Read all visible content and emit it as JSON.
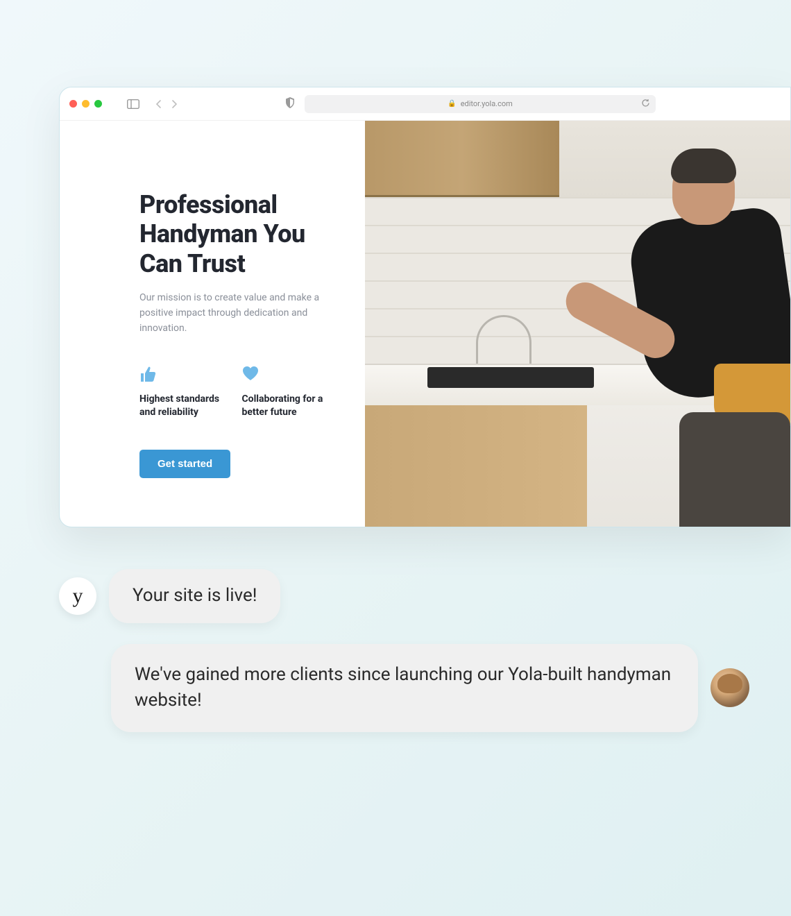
{
  "browser": {
    "address": "editor.yola.com"
  },
  "site": {
    "heading": "Professional Handyman You Can Trust",
    "mission": "Our mission is to create value and make a positive impact through dedication and innovation.",
    "features": [
      {
        "label": "Highest standards and reliability"
      },
      {
        "label": "Collaborating for a better future"
      }
    ],
    "cta_label": "Get started"
  },
  "chat": {
    "yola_letter": "y",
    "message1": "Your site is live!",
    "message2": "We've gained more clients since launching our Yola-built handyman website!"
  }
}
